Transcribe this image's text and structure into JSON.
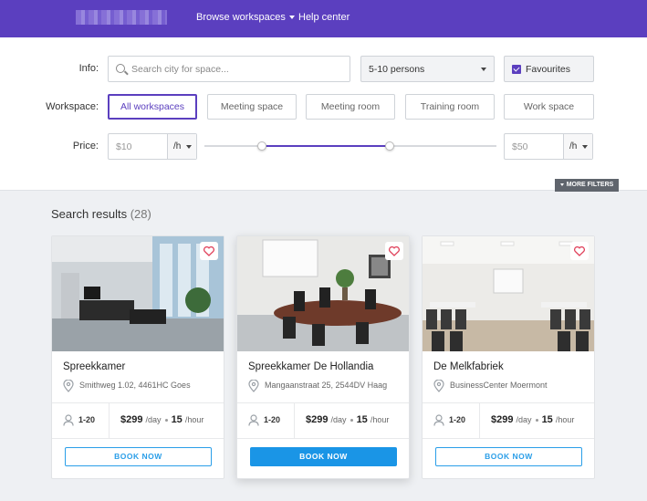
{
  "nav": {
    "browse": "Browse workspaces",
    "help": "Help center"
  },
  "filters": {
    "info_label": "Info:",
    "search_placeholder": "Search city for space...",
    "persons": "5-10 persons",
    "favourites": "Favourites",
    "workspace_label": "Workspace:",
    "workspace_options": [
      "All workspaces",
      "Meeting space",
      "Meeting room",
      "Training room",
      "Work space"
    ],
    "active_workspace": "All workspaces",
    "price_label": "Price:",
    "price_min": "$10",
    "price_max": "$50",
    "unit": "/h",
    "more_filters": "MORE FILTERS"
  },
  "results": {
    "title": "Search results",
    "count": "(28)",
    "cards": [
      {
        "name": "Spreekkamer",
        "address": "Smithweg 1.02, 4461HC Goes",
        "capacity": "1-20",
        "price_day": "$299",
        "per_day": "/day",
        "price_hour": "15",
        "per_hour": "/hour",
        "book": "BOOK NOW"
      },
      {
        "name": "Spreekkamer De Hollandia",
        "address": "Mangaanstraat 25, 2544DV  Haag",
        "capacity": "1-20",
        "price_day": "$299",
        "per_day": "/day",
        "price_hour": "15",
        "per_hour": "/hour",
        "book": "BOOK NOW"
      },
      {
        "name": "De Melkfabriek",
        "address": "BusinessCenter Moermont",
        "capacity": "1-20",
        "price_day": "$299",
        "per_day": "/day",
        "price_hour": "15",
        "per_hour": "/hour",
        "book": "BOOK NOW"
      }
    ]
  },
  "colors": {
    "brand": "#5b3fbf",
    "button_blue": "#1a95e6",
    "heart": "#e0405a"
  },
  "icons": [
    "search-icon",
    "chevron-down-icon",
    "checkbox-checked-icon",
    "heart-icon",
    "location-pin-icon",
    "person-icon"
  ]
}
